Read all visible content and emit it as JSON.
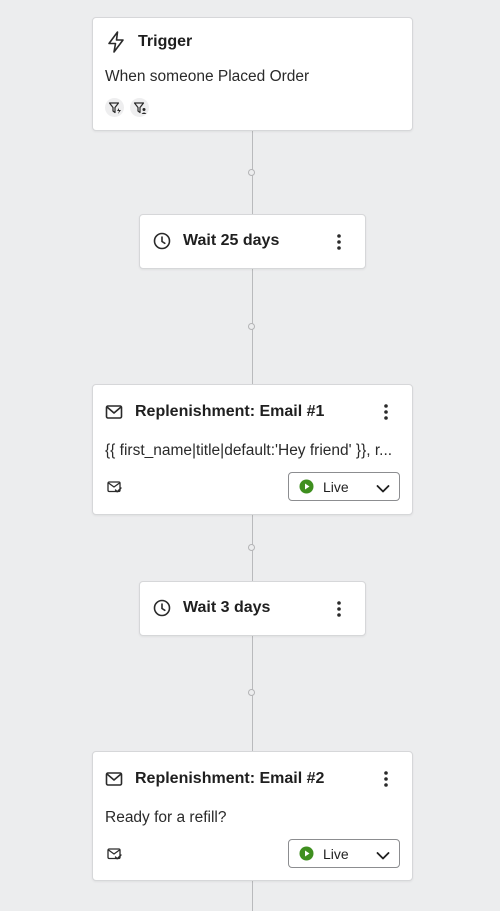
{
  "colors": {
    "canvas": "#ecedee",
    "card": "#ffffff",
    "live_green": "#3f8f1f",
    "connector": "#b9babc"
  },
  "trigger": {
    "title": "Trigger",
    "description": "When someone Placed Order",
    "icon": "lightning-icon",
    "filter_icons": [
      "trigger-filter-icon",
      "profile-filter-icon"
    ]
  },
  "wait_1": {
    "label": "Wait 25 days",
    "icon": "clock-icon"
  },
  "email_1": {
    "title": "Replenishment: Email #1",
    "preview": "{{ first_name|title|default:'Hey friend' }}, r...",
    "status": "Live",
    "icon": "mail-icon"
  },
  "wait_2": {
    "label": "Wait 3 days",
    "icon": "clock-icon"
  },
  "email_2": {
    "title": "Replenishment: Email #2",
    "preview": "Ready for a refill?",
    "status": "Live",
    "icon": "mail-icon"
  }
}
